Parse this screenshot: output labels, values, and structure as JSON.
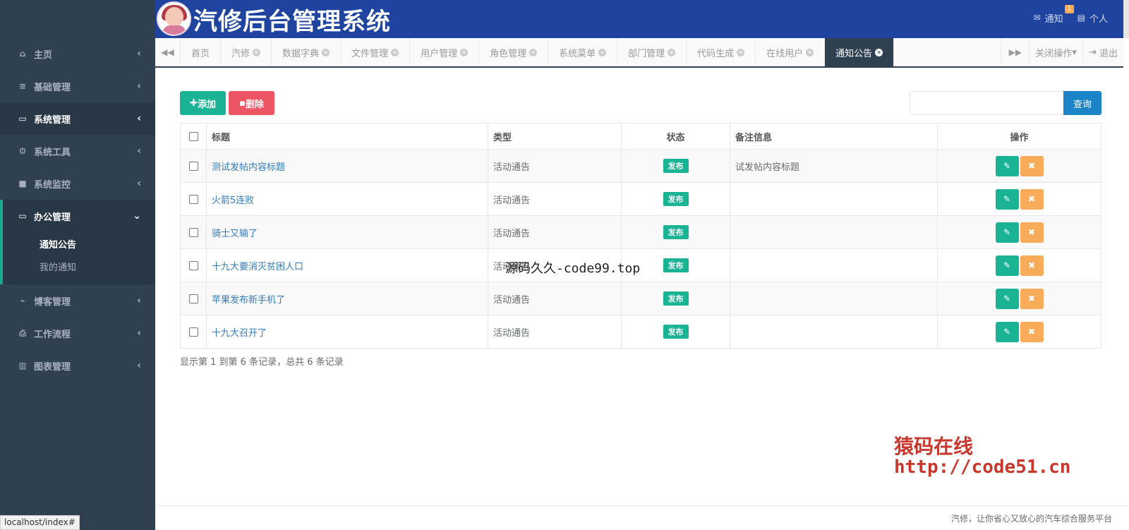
{
  "app": {
    "title": "汽修后台管理系统"
  },
  "header": {
    "notify_label": "通知",
    "notify_badge": "1",
    "personal_label": "个人"
  },
  "sidebar": {
    "items": [
      {
        "label": "主页",
        "icon": "home-icon"
      },
      {
        "label": "基础管理",
        "icon": "list-icon"
      },
      {
        "label": "系统管理",
        "icon": "desktop-icon"
      },
      {
        "label": "系统工具",
        "icon": "gear-icon"
      },
      {
        "label": "系统监控",
        "icon": "video-camera-icon"
      },
      {
        "label": "办公管理",
        "icon": "laptop-icon",
        "expanded": true,
        "children": [
          {
            "label": "通知公告",
            "current": true
          },
          {
            "label": "我的通知"
          }
        ]
      },
      {
        "label": "博客管理",
        "icon": "rss-icon"
      },
      {
        "label": "工作流程",
        "icon": "print-icon"
      },
      {
        "label": "图表管理",
        "icon": "bar-chart-icon"
      }
    ]
  },
  "tabs": {
    "items": [
      "首页",
      "汽修",
      "数据字典",
      "文件管理",
      "用户管理",
      "角色管理",
      "系统菜单",
      "部门管理",
      "代码生成",
      "在线用户",
      "通知公告"
    ],
    "active": "通知公告",
    "close_ops_label": "关闭操作",
    "logout_label": "退出"
  },
  "toolbar": {
    "add_label": "添加",
    "delete_label": "删除",
    "search_placeholder": "",
    "search_label": "查询"
  },
  "table": {
    "headers": {
      "title": "标题",
      "type": "类型",
      "status": "状态",
      "remark": "备注信息",
      "ops": "操作"
    },
    "rows": [
      {
        "title": "测试发帖内容标题",
        "type": "活动通告",
        "status": "发布",
        "remark": "试发帖内容标题"
      },
      {
        "title": "火箭5连败",
        "type": "活动通告",
        "status": "发布",
        "remark": ""
      },
      {
        "title": "骑士又输了",
        "type": "活动通告",
        "status": "发布",
        "remark": ""
      },
      {
        "title": "十九大要消灭贫困人口",
        "type": "活动通告",
        "status": "发布",
        "remark": ""
      },
      {
        "title": "苹果发布新手机了",
        "type": "活动通告",
        "status": "发布",
        "remark": ""
      },
      {
        "title": "十九大召开了",
        "type": "活动通告",
        "status": "发布",
        "remark": ""
      }
    ]
  },
  "pagination": {
    "info": "显示第 1 到第 6 条记录，总共 6 条记录"
  },
  "watermarks": {
    "middle": "源码久久-code99.top",
    "red_line1": "猿码在线",
    "red_line2": "http://code51.cn"
  },
  "footer": {
    "text": "汽修，让你省心又放心的汽车综合服务平台"
  },
  "status_bar": {
    "url": "localhost/index#"
  },
  "colors": {
    "sidebar": "#2f4050",
    "header": "#1e44a0",
    "primary": "#1ab394",
    "danger": "#ed5565",
    "warning": "#f8ac59",
    "info": "#1c84c6"
  }
}
